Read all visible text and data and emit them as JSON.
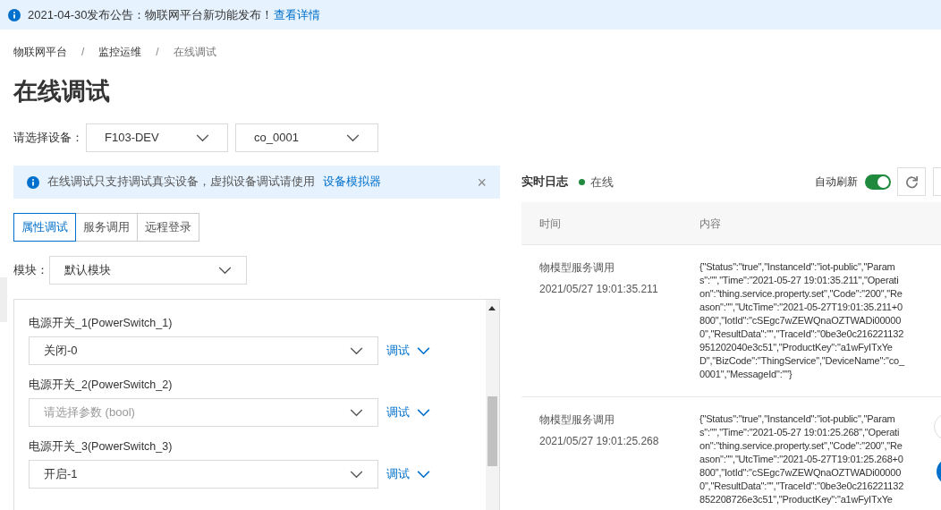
{
  "announcement": {
    "text": "2021-04-30发布公告：物联网平台新功能发布！",
    "link": "查看详情"
  },
  "breadcrumb": [
    "物联网平台",
    "监控运维",
    "在线调试"
  ],
  "breadcrumb_separator": "/",
  "title": "在线调试",
  "device_picker": {
    "label": "请选择设备：",
    "product": "F103-DEV",
    "device": "co_0001"
  },
  "notice": {
    "text": "在线调试只支持调试真实设备，虚拟设备调试请使用",
    "link": "设备模拟器",
    "close": "×"
  },
  "tabs": [
    {
      "label": "属性调试",
      "selected": true
    },
    {
      "label": "服务调用",
      "selected": false
    },
    {
      "label": "远程登录",
      "selected": false
    }
  ],
  "module": {
    "label": "模块：",
    "value": "默认模块"
  },
  "properties": [
    {
      "label": "电源开关_1(PowerSwitch_1)",
      "value": "关闭-0",
      "action": "调试"
    },
    {
      "label": "电源开关_2(PowerSwitch_2)",
      "placeholder": "请选择参数 (bool)",
      "action": "调试"
    },
    {
      "label": "电源开关_3(PowerSwitch_3)",
      "value": "开启-1",
      "action": "调试"
    }
  ],
  "log": {
    "title": "实时日志",
    "status": {
      "text": "在线",
      "color": "#1f8a3e"
    },
    "auto_refresh": {
      "label": "自动刷新",
      "on": true
    },
    "columns": [
      "时间",
      "内容"
    ],
    "rows": [
      {
        "type": "物模型服务调用",
        "time": "2021/05/27 19:01:35.211",
        "content": [
          "{\"Status\":\"true\",\"InstanceId\":\"iot-public\",\"Param",
          "s\":\"\",\"Time\":\"2021-05-27 19:01:35.211\",\"Operati",
          "on\":\"thing.service.property.set\",\"Code\":\"200\",\"Re",
          "ason\":\"\",\"UtcTime\":\"2021-05-27T19:01:35.211+0",
          "800\",\"IotId\":\"cSEgc7wZEWQnaOZTWADi00000",
          "0\",\"ResultData\":\"\",\"TraceId\":\"0be3e0c216221132",
          "951202040e3c51\",\"ProductKey\":\"a1wFyITxYe",
          "D\",\"BizCode\":\"ThingService\",\"DeviceName\":\"co_",
          "0001\",\"MessageId\":\"\"}"
        ]
      },
      {
        "type": "物模型服务调用",
        "time": "2021/05/27 19:01:25.268",
        "content": [
          "{\"Status\":\"true\",\"InstanceId\":\"iot-public\",\"Param",
          "s\":\"\",\"Time\":\"2021-05-27 19:01:25.268\",\"Operati",
          "on\":\"thing.service.property.set\",\"Code\":\"200\",\"Re",
          "ason\":\"\",\"UtcTime\":\"2021-05-27T19:01:25.268+0",
          "800\",\"IotId\":\"cSEgc7wZEWQnaOZTWADi00000",
          "0\",\"ResultData\":\"\",\"TraceId\":\"0be3e0c216221132",
          "852208726e3c51\",\"ProductKey\":\"a1wFyITxYe"
        ]
      }
    ]
  }
}
